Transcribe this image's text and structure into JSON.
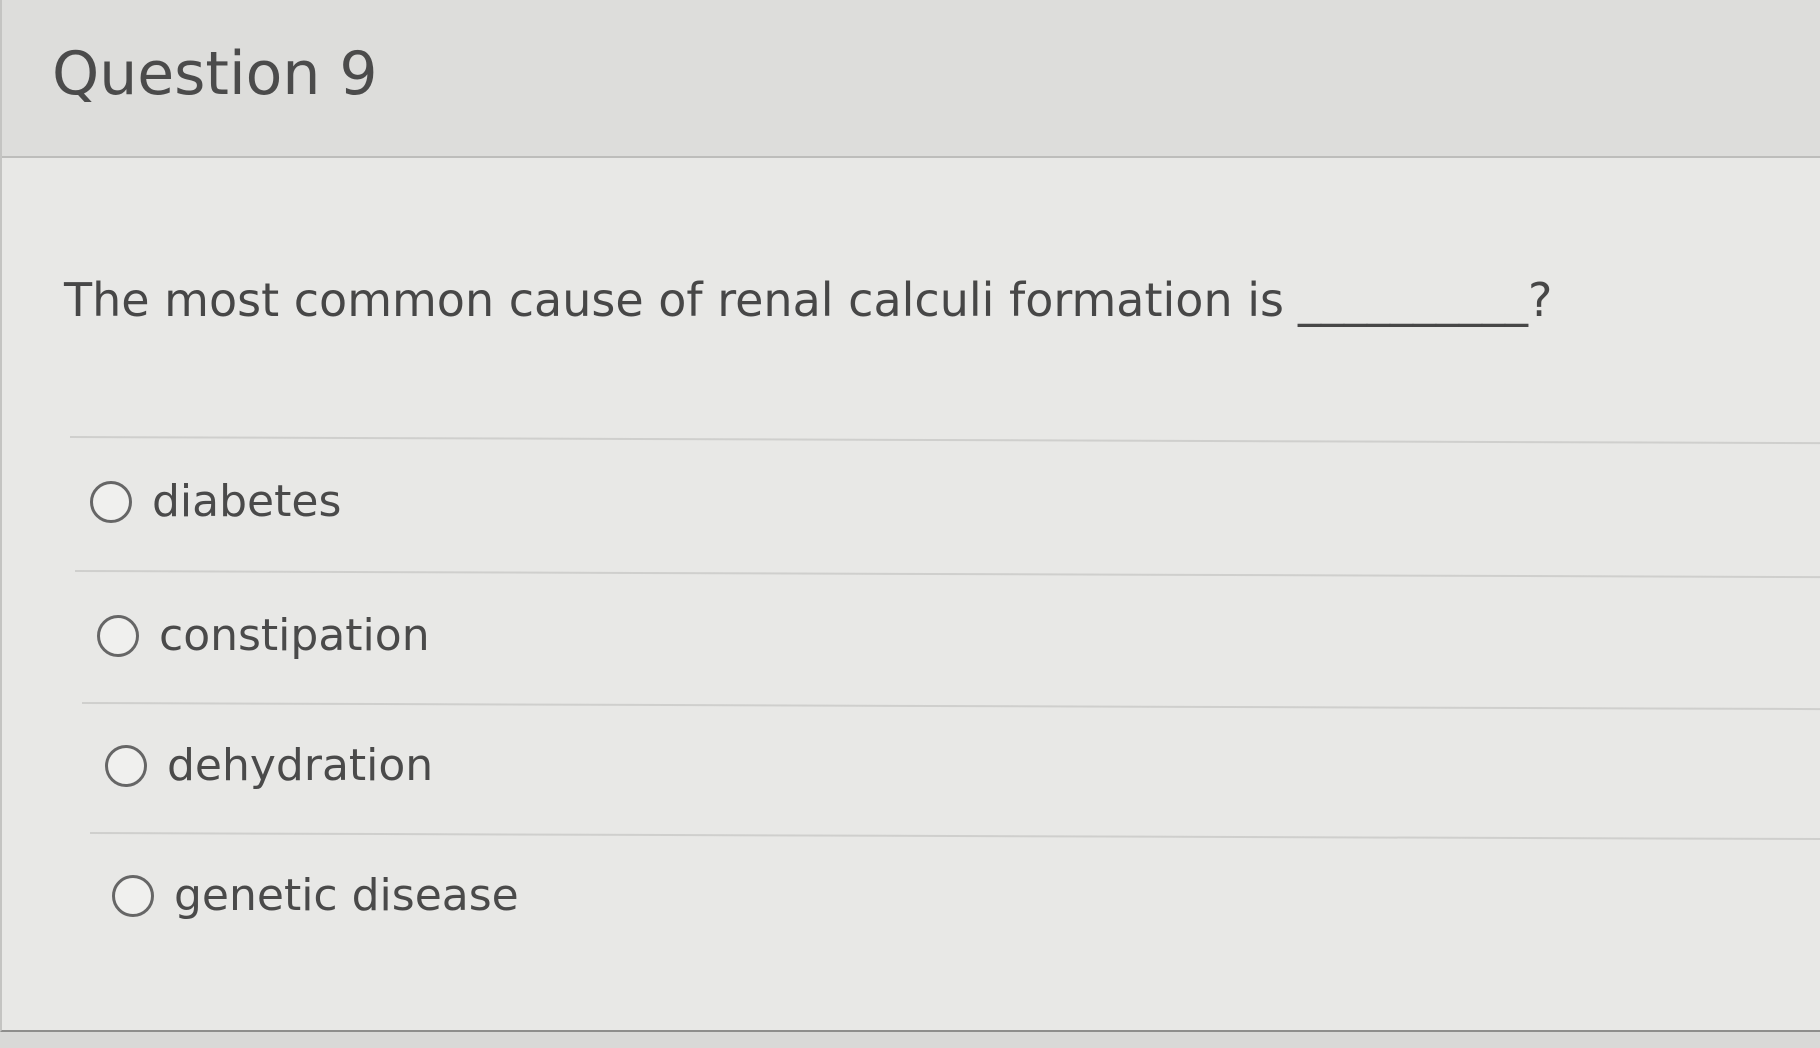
{
  "question": {
    "title": "Question 9",
    "prompt": "The most common cause of renal calculi formation is",
    "blank": "__________?"
  },
  "answers": [
    {
      "label": "diabetes",
      "selected": false
    },
    {
      "label": "constipation",
      "selected": false
    },
    {
      "label": "dehydration",
      "selected": false
    },
    {
      "label": "genetic disease",
      "selected": false
    }
  ],
  "colors": {
    "background": "#e8e8e6",
    "header_background": "#dddddb",
    "text": "#4a4a4a",
    "radio_border": "#666666",
    "divider": "#cfcfcd"
  },
  "icons": {
    "radio": "empty-radio-circle-icon"
  }
}
